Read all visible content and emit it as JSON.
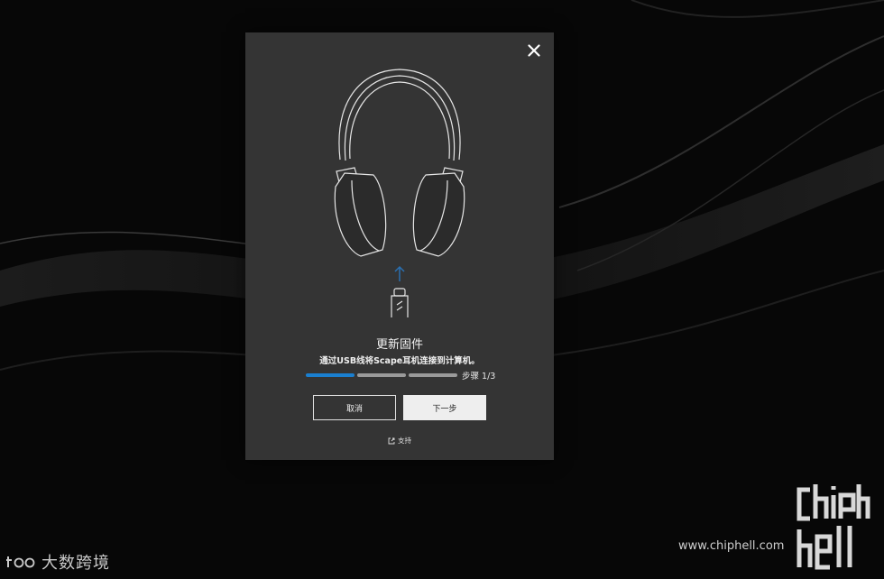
{
  "dialog": {
    "title": "更新固件",
    "instruction": "通过USB线将Scape耳机连接到计算机。",
    "steps_total": 3,
    "step_current": 1,
    "step_label": "步骤 1/3",
    "buttons": {
      "cancel": "取消",
      "next": "下一步"
    },
    "support_link": "支持",
    "close_icon": "close-icon"
  },
  "colors": {
    "dialog_bg": "#343434",
    "progress_active": "#1a7fd0",
    "progress_inactive": "#9a9a9a",
    "arrow": "#2a6fb0"
  },
  "watermarks": {
    "left_brand": "大数跨境",
    "left_logo_text": "t00",
    "right_url": "www.chiphell.com",
    "right_logo_text": "chiphell"
  }
}
